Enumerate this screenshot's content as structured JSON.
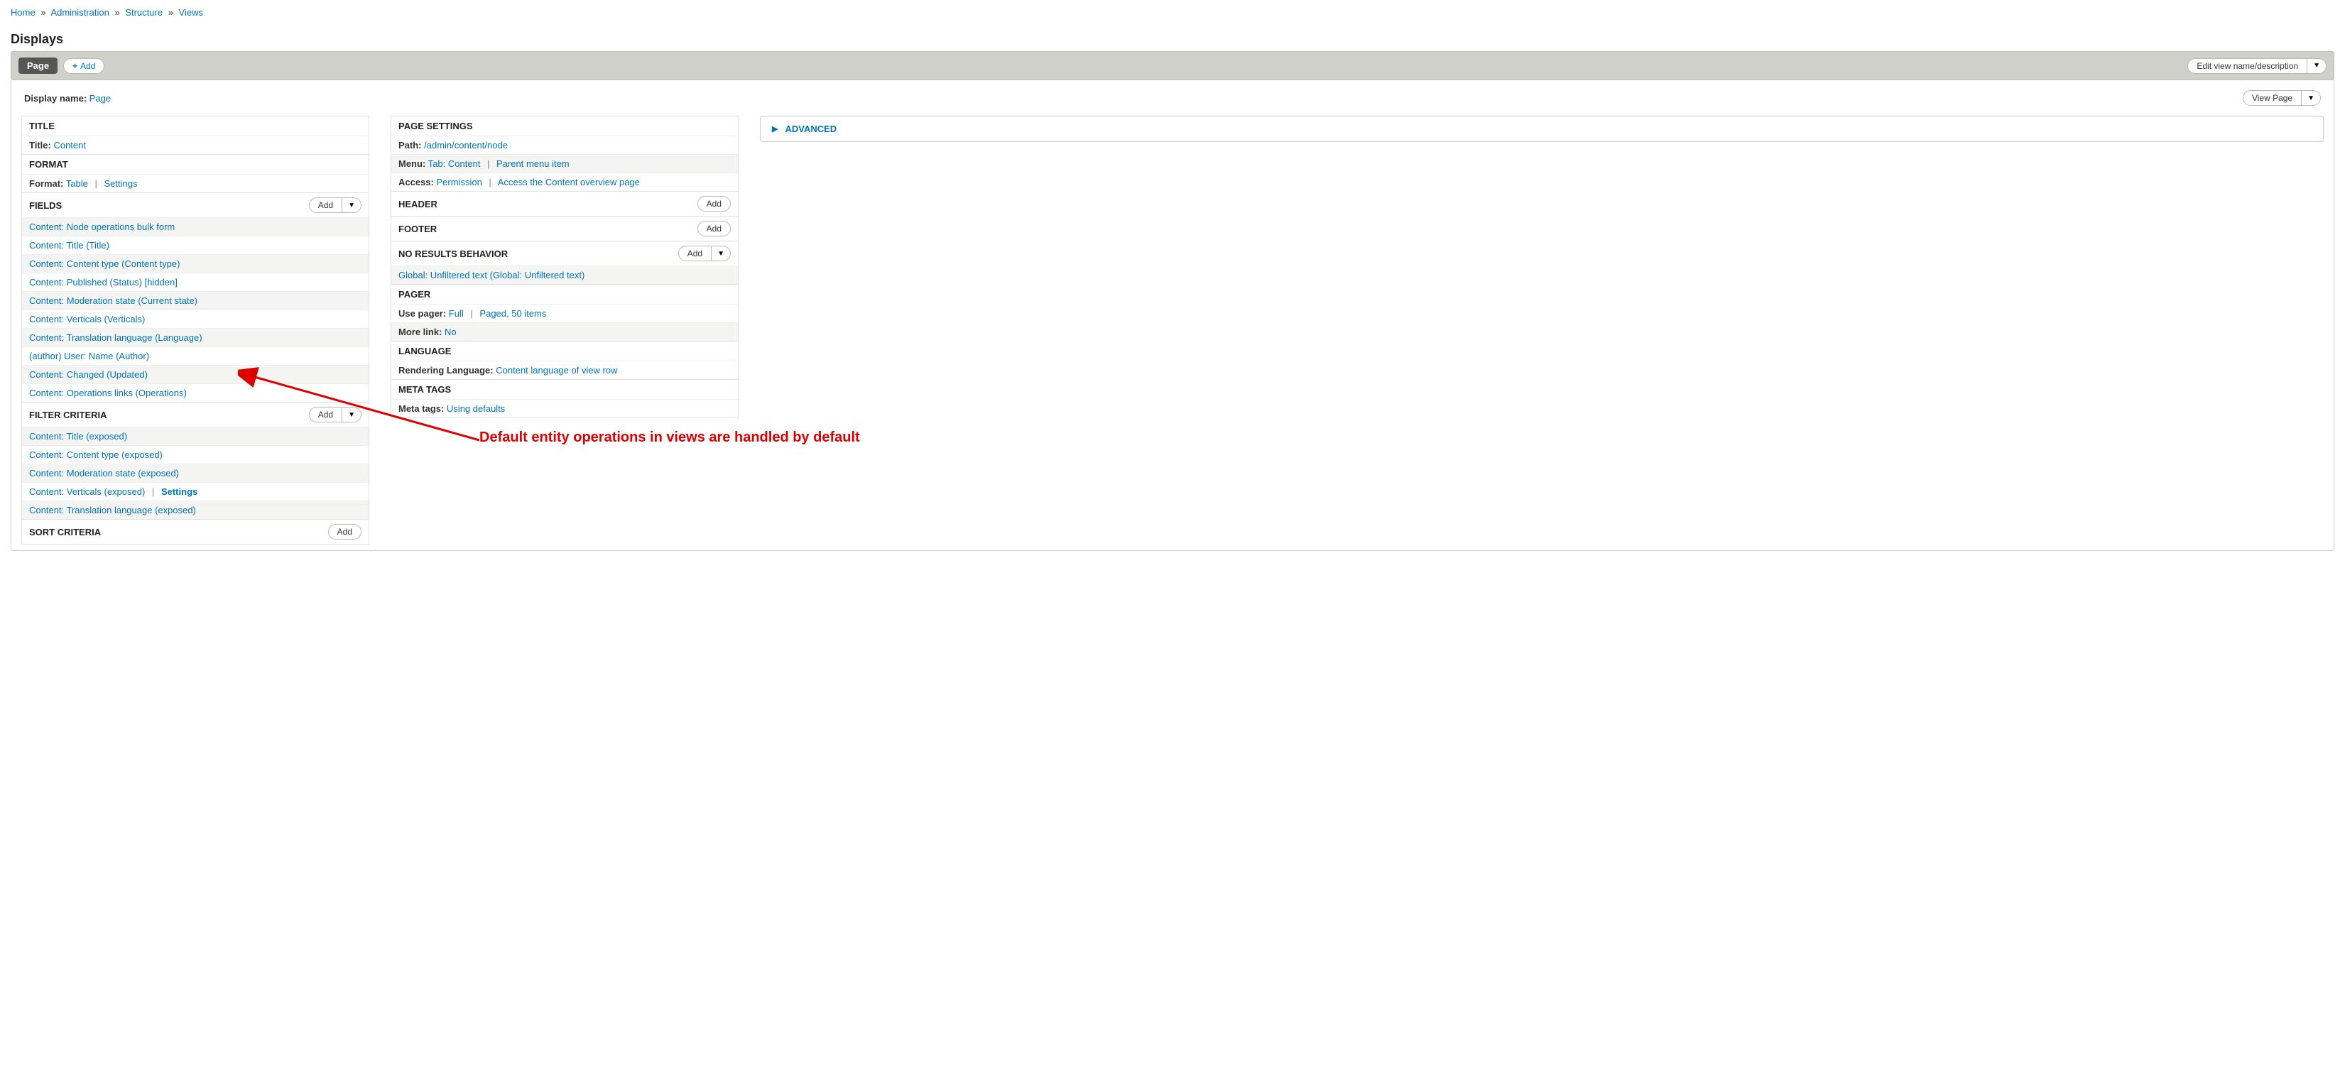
{
  "breadcrumb": {
    "home": "Home",
    "admin": "Administration",
    "structure": "Structure",
    "views": "Views"
  },
  "displays_title": "Displays",
  "displays_bar": {
    "page_tab": "Page",
    "add": "Add",
    "edit_name": "Edit view name/description"
  },
  "display_name_row": {
    "label": "Display name:",
    "value": "Page",
    "view_page": "View Page"
  },
  "col1": {
    "title_section": {
      "header": "TITLE",
      "title_label": "Title:",
      "title_value": "Content"
    },
    "format_section": {
      "header": "FORMAT",
      "format_label": "Format:",
      "format_value": "Table",
      "settings": "Settings"
    },
    "fields_section": {
      "header": "FIELDS",
      "add": "Add",
      "items": [
        "Content: Node operations bulk form",
        "Content: Title (Title)",
        "Content: Content type (Content type)",
        "Content: Published (Status) [hidden]",
        "Content: Moderation state (Current state)",
        "Content: Verticals (Verticals)",
        "Content: Translation language (Language)",
        "(author) User: Name (Author)",
        "Content: Changed (Updated)",
        "Content: Operations links (Operations)"
      ]
    },
    "filter_section": {
      "header": "FILTER CRITERIA",
      "add": "Add",
      "items": [
        {
          "text": "Content: Title (exposed)"
        },
        {
          "text": "Content: Content type (exposed)"
        },
        {
          "text": "Content: Moderation state (exposed)"
        },
        {
          "text": "Content: Verticals (exposed)",
          "extra": "Settings"
        },
        {
          "text": "Content: Translation language (exposed)"
        }
      ]
    },
    "sort_section": {
      "header": "SORT CRITERIA",
      "add": "Add"
    }
  },
  "col2": {
    "page_settings": {
      "header": "PAGE SETTINGS",
      "path_label": "Path:",
      "path_value": "/admin/content/node",
      "menu_label": "Menu:",
      "menu_value": "Tab: Content",
      "menu_parent": "Parent menu item",
      "access_label": "Access:",
      "access_value": "Permission",
      "access_extra": "Access the Content overview page"
    },
    "header_section": {
      "header": "HEADER",
      "add": "Add"
    },
    "footer_section": {
      "header": "FOOTER",
      "add": "Add"
    },
    "noresults_section": {
      "header": "NO RESULTS BEHAVIOR",
      "add": "Add",
      "item": "Global: Unfiltered text (Global: Unfiltered text)"
    },
    "pager_section": {
      "header": "PAGER",
      "use_label": "Use pager:",
      "use_value": "Full",
      "use_extra": "Paged, 50 items",
      "more_label": "More link:",
      "more_value": "No"
    },
    "language_section": {
      "header": "LANGUAGE",
      "render_label": "Rendering Language:",
      "render_value": "Content language of view row"
    },
    "meta_section": {
      "header": "META TAGS",
      "meta_label": "Meta tags:",
      "meta_value": "Using defaults"
    }
  },
  "col3": {
    "advanced": "ADVANCED"
  },
  "annotation": {
    "text": "Default entity operations in views are handled by default"
  }
}
